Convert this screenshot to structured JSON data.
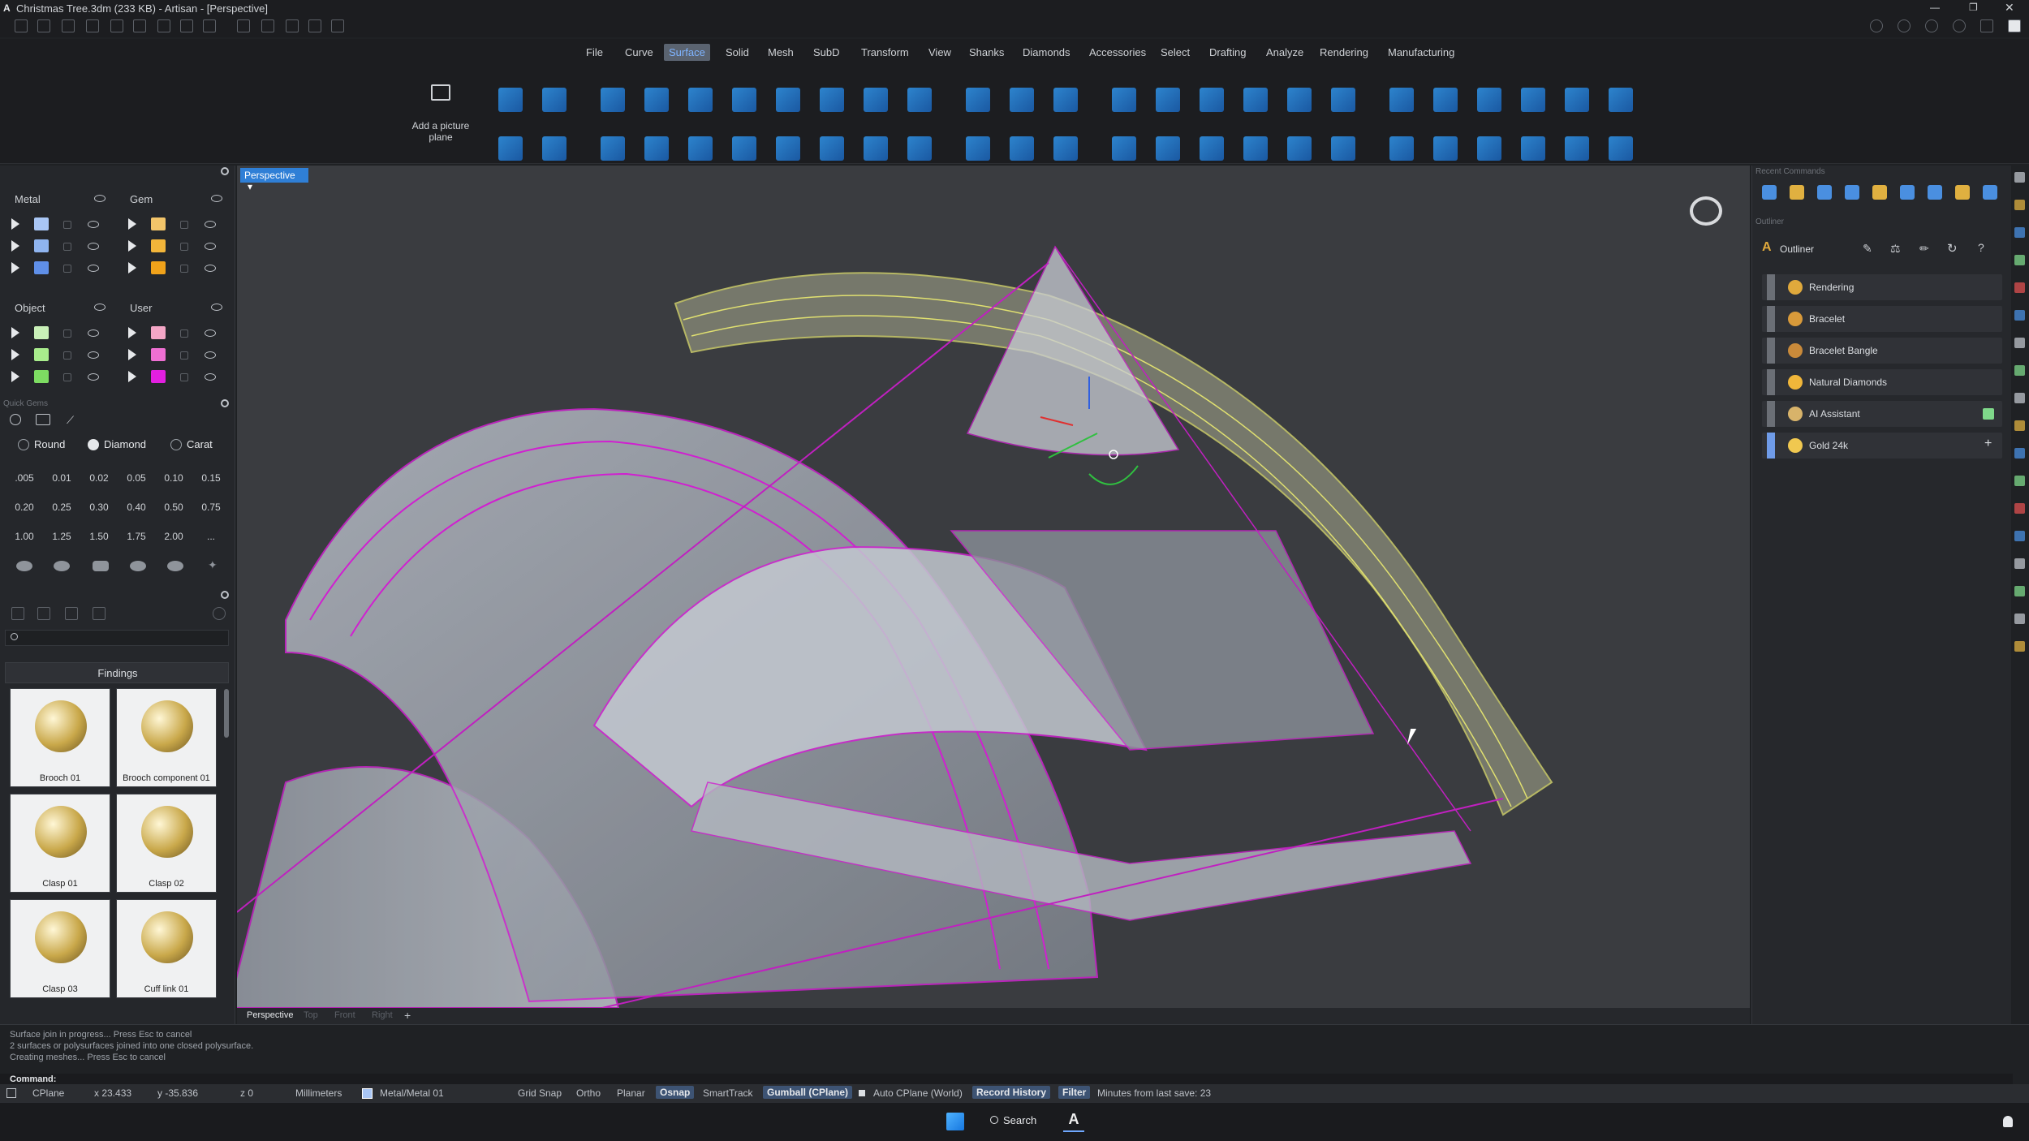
{
  "window": {
    "title": "Christmas Tree.3dm (233 KB) - Artisan - [Perspective]"
  },
  "menu": {
    "items": [
      "File",
      "Curve",
      "Surface",
      "Solid",
      "Mesh",
      "SubD",
      "Transform",
      "View",
      "Shanks",
      "Diamonds",
      "Accessories",
      "Select",
      "Drafting",
      "Analyze",
      "Rendering",
      "Manufacturing"
    ],
    "active": "Surface"
  },
  "ribbon": {
    "picture_plane_label": "Add a picture plane"
  },
  "layers": {
    "metal_title": "Metal",
    "gem_title": "Gem",
    "object_title": "Object",
    "user_title": "User",
    "metal_colors": [
      "#a9c6f5",
      "#8fb4ef",
      "#5f8fe8"
    ],
    "gem_colors": [
      "#f3c56a",
      "#f2b53a",
      "#f0a21a"
    ],
    "object_colors": [
      "#c9f0b8",
      "#a8ec8c",
      "#7ddc62"
    ],
    "user_colors": [
      "#f4a6c6",
      "#ee6fd2",
      "#e21fe0"
    ]
  },
  "quick_gems": {
    "title": "Quick Gems",
    "tabs": [
      "Round",
      "Diamond",
      "Carat"
    ],
    "selected_tab": "Diamond",
    "sizes": [
      ".005",
      "0.01",
      "0.02",
      "0.05",
      "0.10",
      "0.15",
      "0.20",
      "0.25",
      "0.30",
      "0.40",
      "0.50",
      "0.75",
      "1.00",
      "1.25",
      "1.50",
      "1.75",
      "2.00",
      "..."
    ]
  },
  "library": {
    "category": "Findings",
    "items": [
      "Brooch 01",
      "Brooch component 01",
      "Clasp 01",
      "Clasp 02",
      "Clasp 03",
      "Cuff link 01"
    ]
  },
  "viewport": {
    "active_tab": "Perspective",
    "bottom_tabs": [
      "Perspective",
      "Top",
      "Front",
      "Right"
    ]
  },
  "right_panel": {
    "recent_commands_title": "Recent Commands",
    "outliner_section": "Outliner",
    "outliner_title": "Outliner",
    "items": [
      {
        "label": "Rendering",
        "icon_color": "#e0a93c"
      },
      {
        "label": "Bracelet",
        "icon_color": "#d89a3a"
      },
      {
        "label": "Bracelet Bangle",
        "icon_color": "#c98a3a"
      },
      {
        "label": "Natural Diamonds",
        "icon_color": "#f0b63a"
      },
      {
        "label": "AI Assistant",
        "icon_color": "#d8b36a"
      },
      {
        "label": "Gold 24k",
        "icon_color": "#f0c850"
      }
    ]
  },
  "command": {
    "history": [
      "Surface join in progress... Press Esc to cancel",
      "2 surfaces or polysurfaces joined into one closed polysurface.",
      "Creating meshes... Press Esc to cancel"
    ],
    "prompt": "Command:"
  },
  "status": {
    "cplane": "CPlane",
    "x": "x 23.433",
    "y": "y -35.836",
    "z": "z 0",
    "units": "Millimeters",
    "layer": "Metal/Metal 01",
    "grid_snap": "Grid Snap",
    "ortho": "Ortho",
    "planar": "Planar",
    "osnap": "Osnap",
    "smarttrack": "SmartTrack",
    "gumball": "Gumball (CPlane)",
    "auto_cplane": "Auto CPlane (World)",
    "record_history": "Record History",
    "filter": "Filter",
    "last_save": "Minutes from last save: 23"
  },
  "taskbar": {
    "search": "Search"
  }
}
